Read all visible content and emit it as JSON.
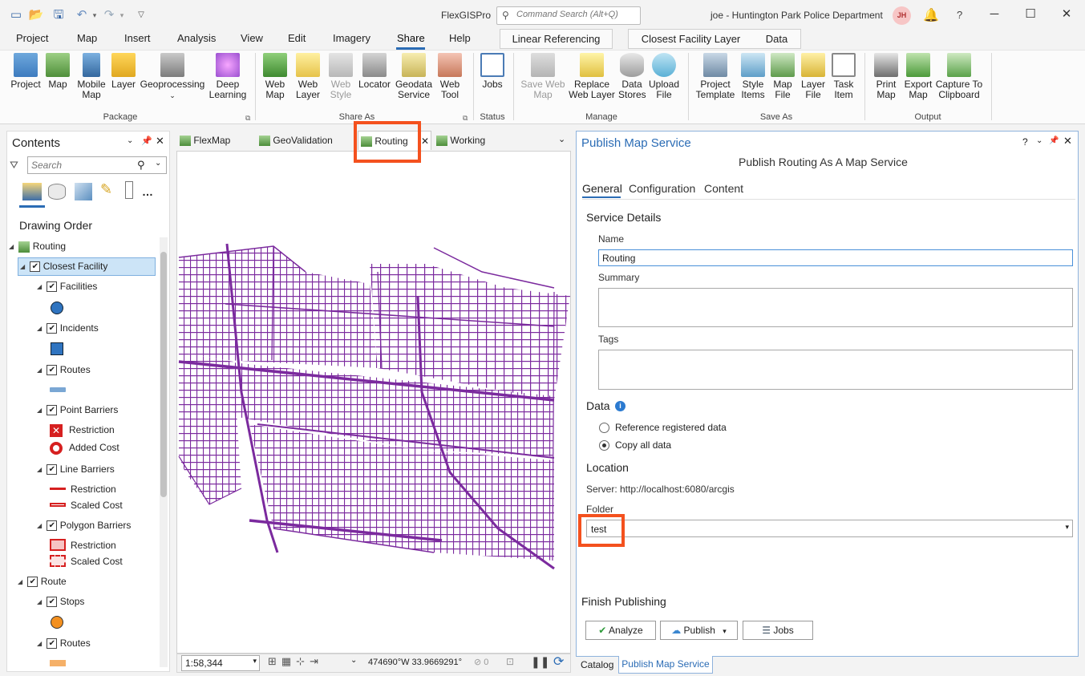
{
  "app": {
    "title": "FlexGISPro",
    "search_placeholder": "Command Search (Alt+Q)",
    "user": "joe - Huntington Park Police Department",
    "avatar_initials": "JH",
    "help": "?"
  },
  "menu_tabs": [
    "Project",
    "Map",
    "Insert",
    "Analysis",
    "View",
    "Edit",
    "Imagery",
    "Share",
    "Help"
  ],
  "context_tabs": [
    "Linear Referencing",
    "Closest Facility Layer",
    "Data"
  ],
  "ribbon": {
    "package": [
      "Project",
      "Map",
      "Mobile Map",
      "Layer",
      "Geoprocessing",
      "Deep Learning"
    ],
    "share_as": [
      "Web Map",
      "Web Layer",
      "Web Style",
      "Locator",
      "Geodata Service",
      "Web Tool"
    ],
    "status": [
      "Jobs"
    ],
    "manage": [
      "Save Web Map",
      "Replace Web Layer",
      "Data Stores",
      "Upload File"
    ],
    "save_as": [
      "Project Template",
      "Style Items",
      "Map File",
      "Layer File",
      "Task Item"
    ],
    "output": [
      "Print Map",
      "Export Map",
      "Capture To Clipboard"
    ],
    "groups": [
      "Package",
      "Share As",
      "Status",
      "Manage",
      "Save As",
      "Output"
    ]
  },
  "contents": {
    "title": "Contents",
    "search_placeholder": "Search",
    "drawing_order": "Drawing Order",
    "tree": {
      "routing": "Routing",
      "closest_facility": "Closest Facility",
      "facilities": "Facilities",
      "incidents": "Incidents",
      "routes": "Routes",
      "point_barriers": "Point Barriers",
      "restriction": "Restriction",
      "added_cost": "Added Cost",
      "line_barriers": "Line Barriers",
      "scaled_cost": "Scaled Cost",
      "polygon_barriers": "Polygon Barriers",
      "route": "Route",
      "stops": "Stops"
    }
  },
  "map_tabs": [
    "FlexMap",
    "GeoValidation",
    "Routing",
    "Working"
  ],
  "map_status": {
    "scale": "1:58,344",
    "coords": "474690°W 33.9669291°",
    "selected": "0"
  },
  "publish": {
    "title": "Publish Map Service",
    "subtitle": "Publish Routing As A Map Service",
    "tabs": [
      "General",
      "Configuration",
      "Content"
    ],
    "service_details": "Service Details",
    "name_label": "Name",
    "name_value": "Routing",
    "summary_label": "Summary",
    "tags_label": "Tags",
    "data_label": "Data",
    "data_options": [
      "Reference registered data",
      "Copy all data"
    ],
    "location_label": "Location",
    "server": "Server: http://localhost:6080/arcgis",
    "folder_label": "Folder",
    "folder_value": "test",
    "finish": "Finish Publishing",
    "buttons": [
      "Analyze",
      "Publish",
      "Jobs"
    ]
  },
  "bottom_tabs": [
    "Catalog",
    "Publish Map Service"
  ],
  "colors": {
    "accent": "#2b6cb5",
    "highlight": "#f4511e",
    "roads": "#7b2a9e"
  }
}
